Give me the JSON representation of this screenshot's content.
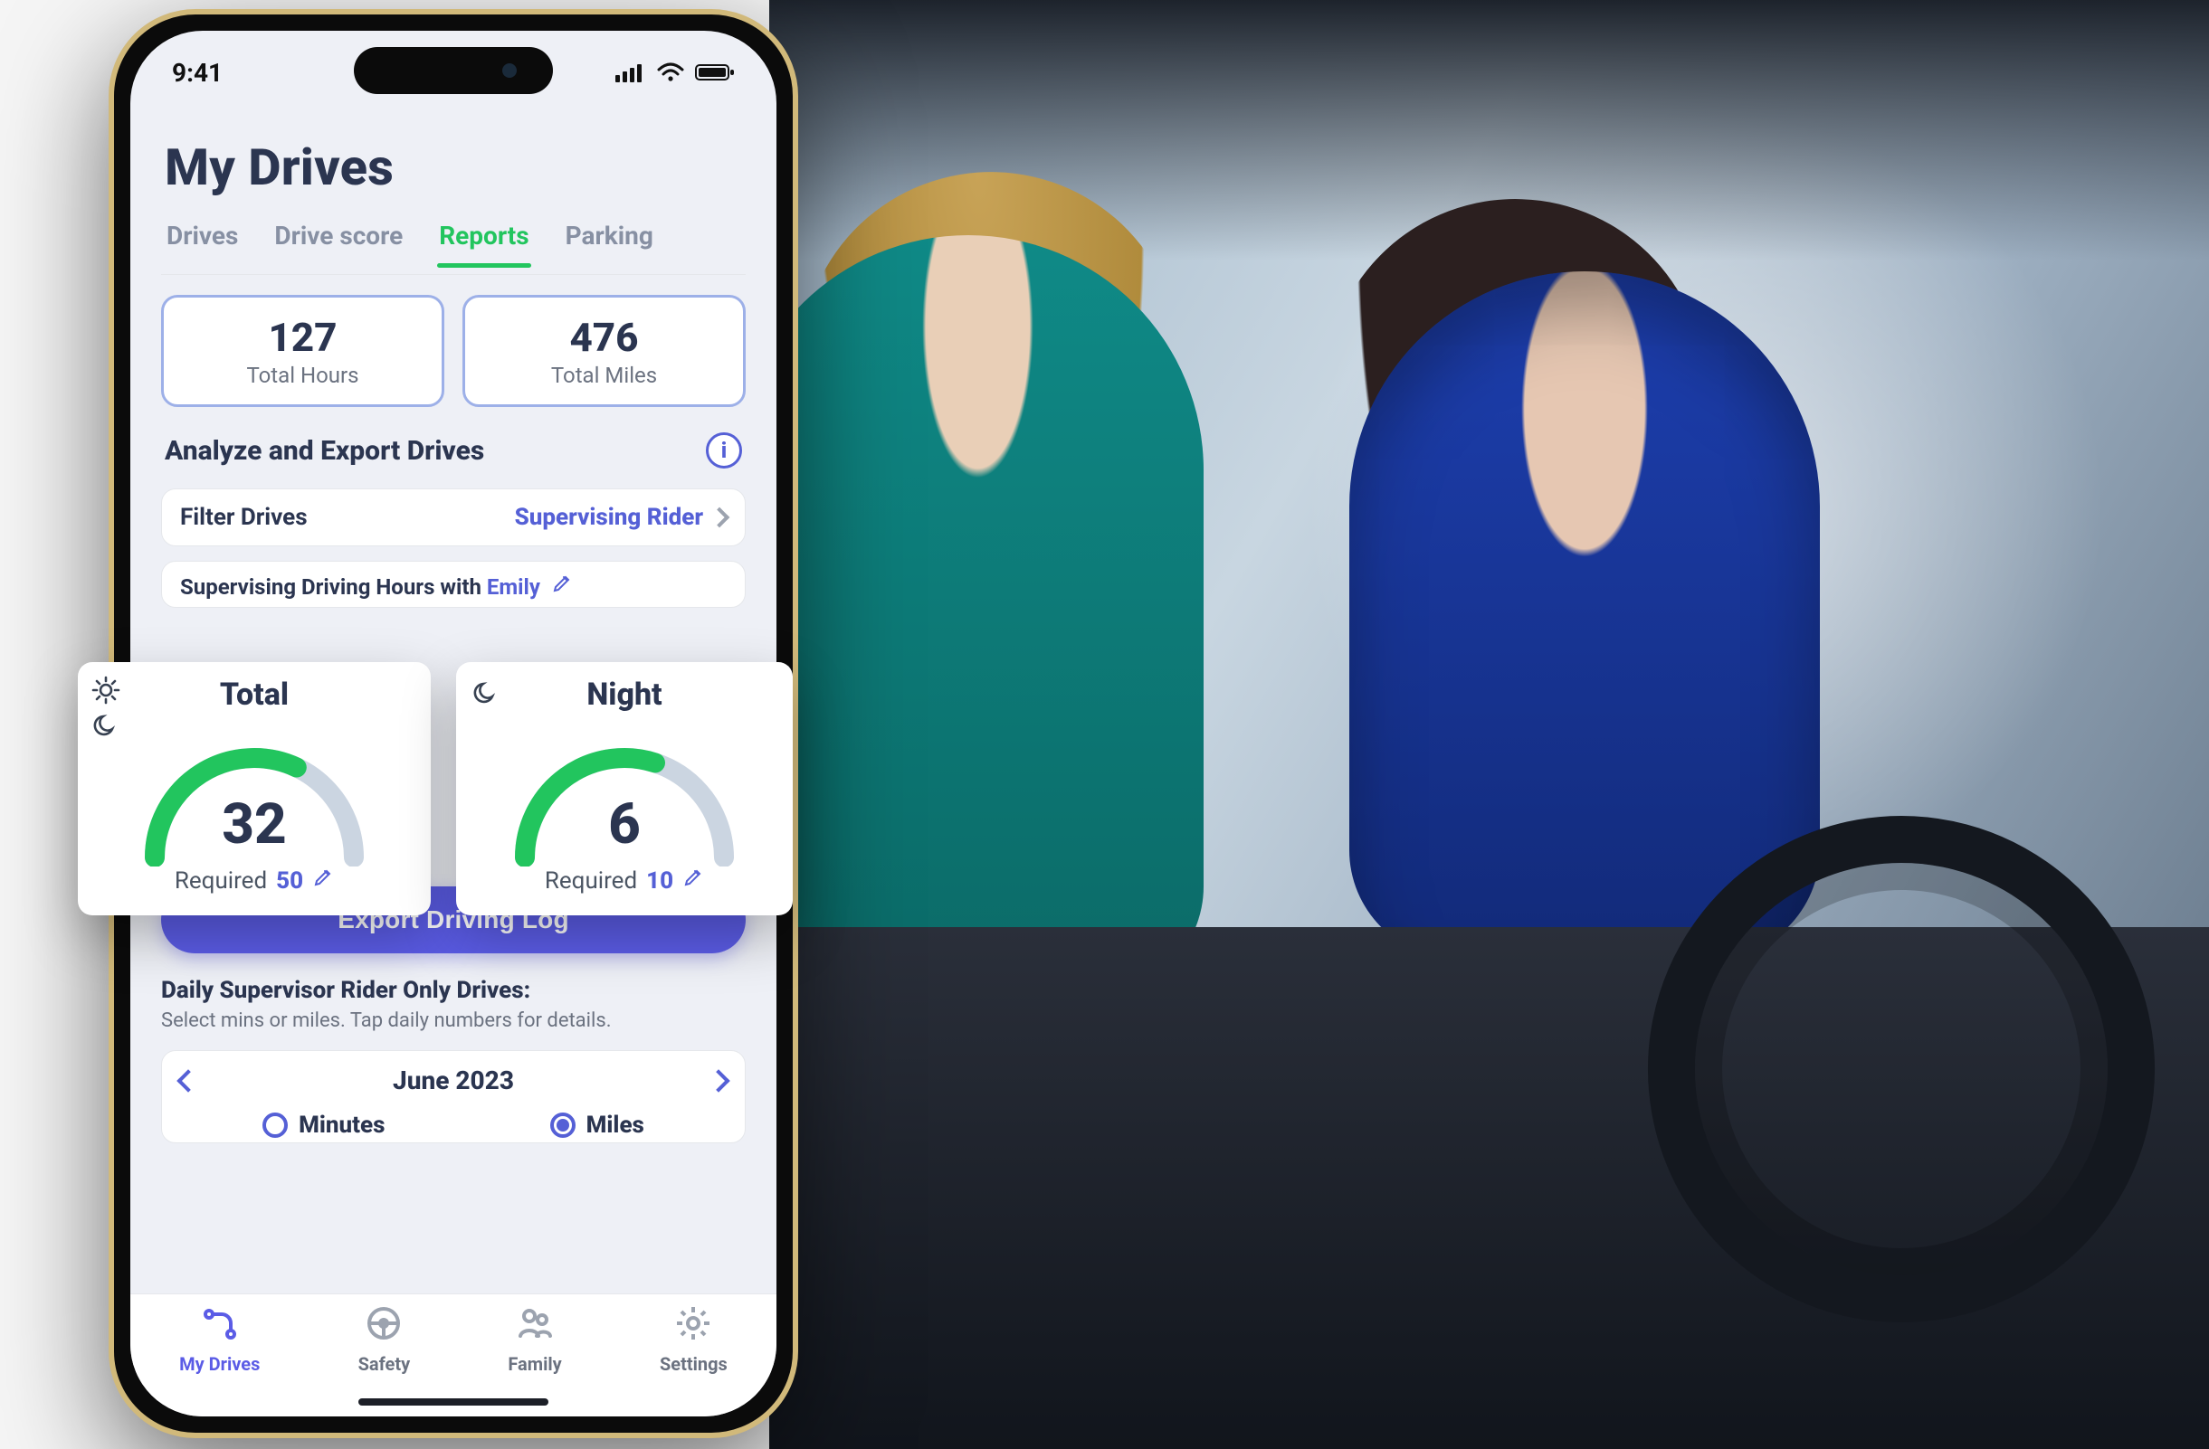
{
  "status": {
    "time": "9:41"
  },
  "page": {
    "title": "My Drives"
  },
  "tabs": {
    "drives": "Drives",
    "score": "Drive score",
    "reports": "Reports",
    "parking": "Parking",
    "active": "reports"
  },
  "summary": {
    "total_hours": {
      "value": "127",
      "label": "Total Hours"
    },
    "total_miles": {
      "value": "476",
      "label": "Total Miles"
    }
  },
  "analyze": {
    "heading": "Analyze and Export Drives",
    "info_label": "i",
    "filter": {
      "label": "Filter Drives",
      "value": "Supervising Rider"
    },
    "supervising_row": {
      "prefix": "Supervising Driving Hours with ",
      "name": "Emily"
    }
  },
  "gauges": {
    "total": {
      "title": "Total",
      "value": "32",
      "required_label": "Required",
      "required": "50",
      "progress": 0.64
    },
    "night": {
      "title": "Night",
      "value": "6",
      "required_label": "Required",
      "required": "10",
      "progress": 0.6
    }
  },
  "cta": {
    "export_label": "Export Driving Log"
  },
  "daily": {
    "title": "Daily Supervisor Rider Only Drives:",
    "subtitle": "Select mins or miles. Tap daily numbers for details.",
    "month": "June 2023",
    "segment": {
      "minutes": "Minutes",
      "miles": "Miles",
      "selected": "miles"
    }
  },
  "tabbar": {
    "my_drives": "My Drives",
    "safety": "Safety",
    "family": "Family",
    "settings": "Settings",
    "active": "my_drives"
  },
  "photo_alt": "A teenage driver in a blue sweater sits at the wheel while an adult passenger with blonde hair supervises from the front seat"
}
